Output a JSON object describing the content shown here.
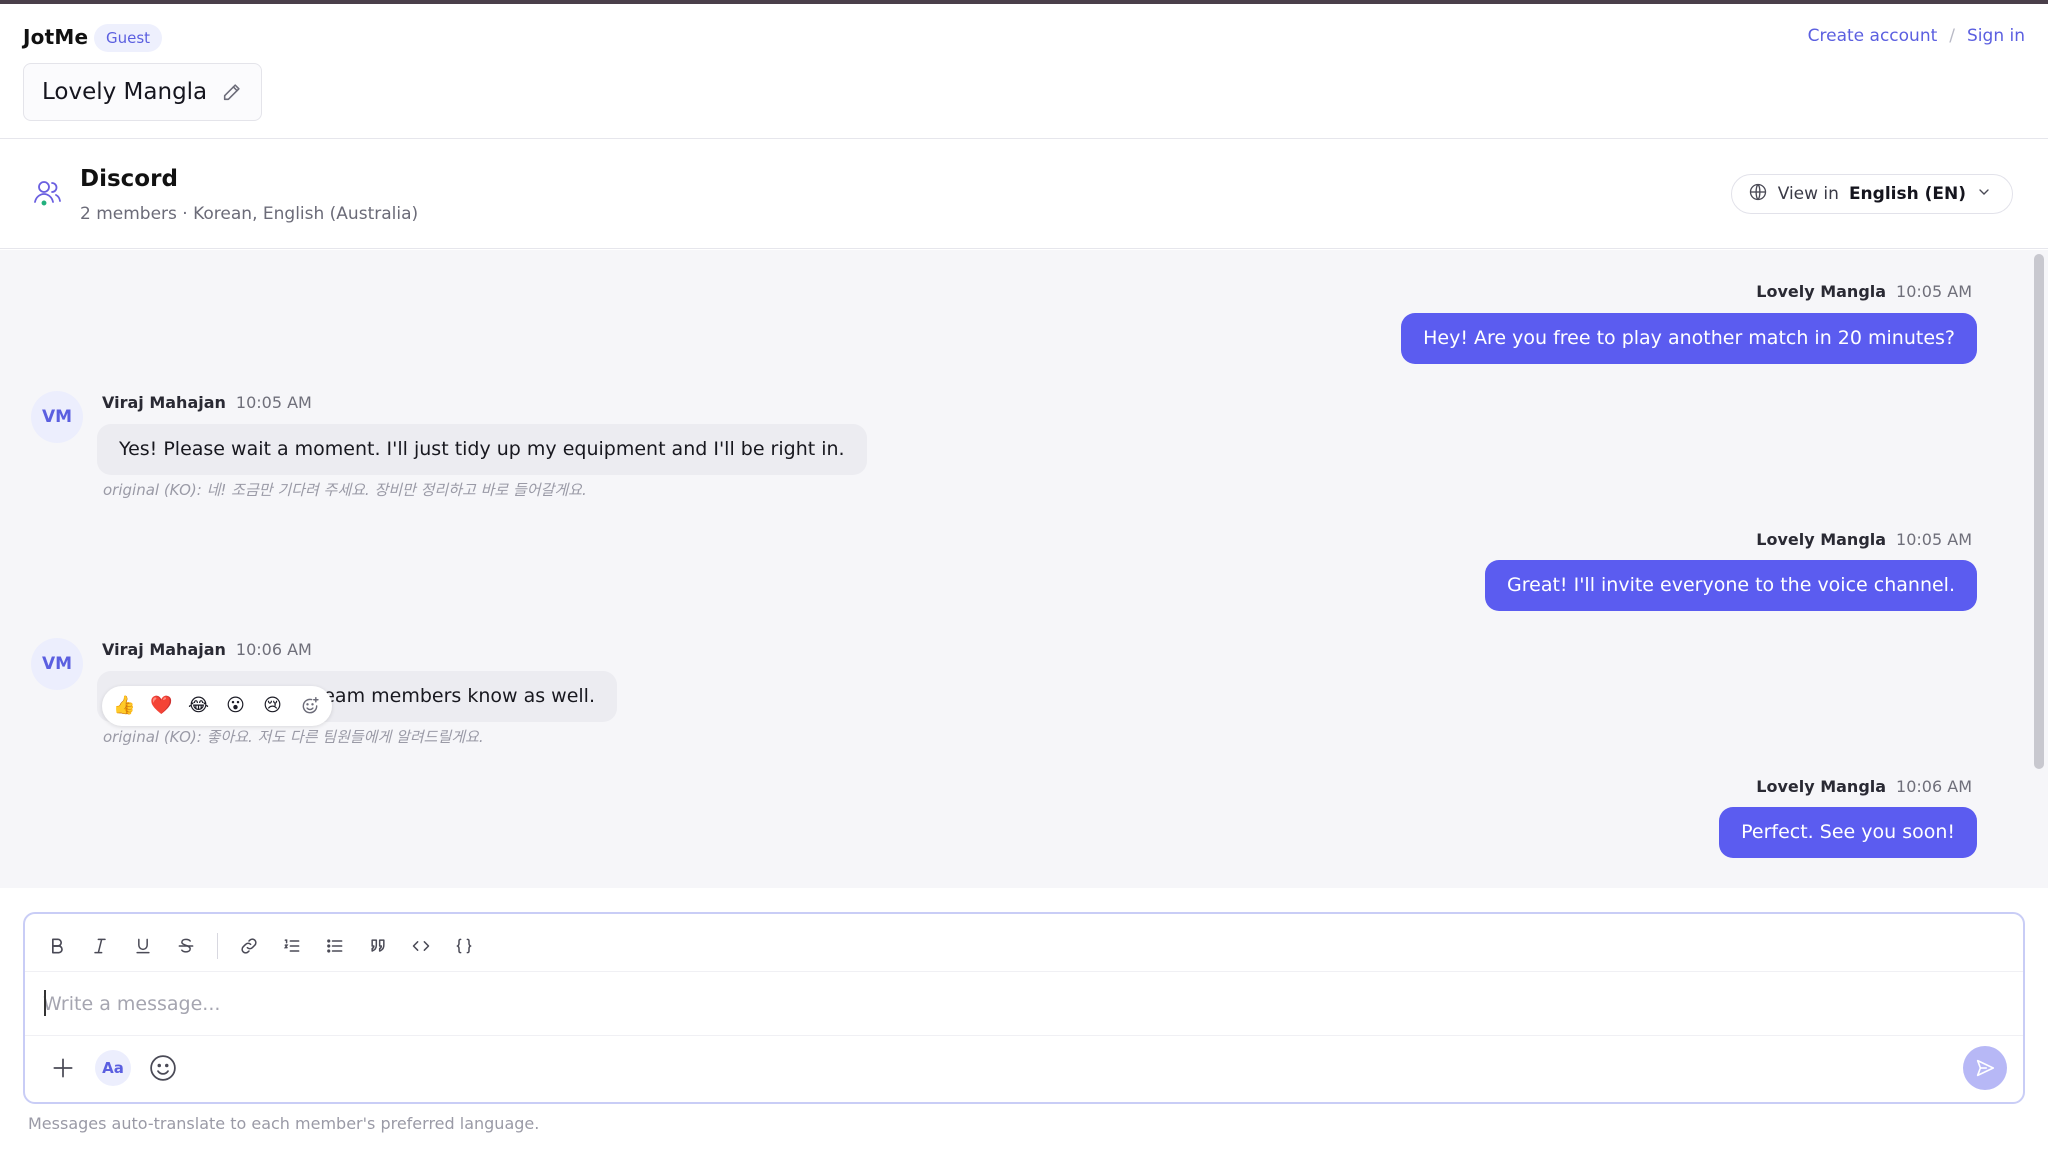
{
  "app": {
    "brand": "JotMe",
    "guest_badge": "Guest",
    "create_account": "Create account",
    "separator": "/",
    "sign_in": "Sign in",
    "conversation_name": "Lovely Mangla"
  },
  "channel": {
    "title": "Discord",
    "meta": "2 members · Korean, English (Australia)",
    "view_in_label": "View in",
    "language": "English (EN)"
  },
  "messages": [
    {
      "direction": "out",
      "author": "Lovely Mangla",
      "time": "10:05 AM",
      "text": "Hey! Are you free to play another match in 20 minutes?"
    },
    {
      "direction": "in",
      "author": "Viraj Mahajan",
      "initials": "VM",
      "time": "10:05 AM",
      "text": "Yes! Please wait a moment. I'll just tidy up my equipment and I'll be right in.",
      "original": "original (KO): 네! 조금만 기다려 주세요. 장비만 정리하고 바로 들어갈게요."
    },
    {
      "direction": "out",
      "author": "Lovely Mangla",
      "time": "10:05 AM",
      "text": "Great! I'll invite everyone to the voice channel."
    },
    {
      "direction": "in",
      "author": "Viraj Mahajan",
      "initials": "VM",
      "time": "10:06 AM",
      "text": "team members know as well.",
      "original": "original (KO): 좋아요. 저도 다른 팀원들에게 알려드릴게요."
    },
    {
      "direction": "out",
      "author": "Lovely Mangla",
      "time": "10:06 AM",
      "text": "Perfect. See you soon!"
    }
  ],
  "reactions": [
    "👍",
    "❤️",
    "😂",
    "😮",
    "😢"
  ],
  "composer": {
    "placeholder": "Write a message...",
    "aa_label": "Aa",
    "footnote": "Messages auto-translate to each member's preferred language."
  },
  "colors": {
    "accent": "#5b5cf0",
    "accent_light": "#eceefd",
    "send_disabled": "#b7b8f6"
  }
}
